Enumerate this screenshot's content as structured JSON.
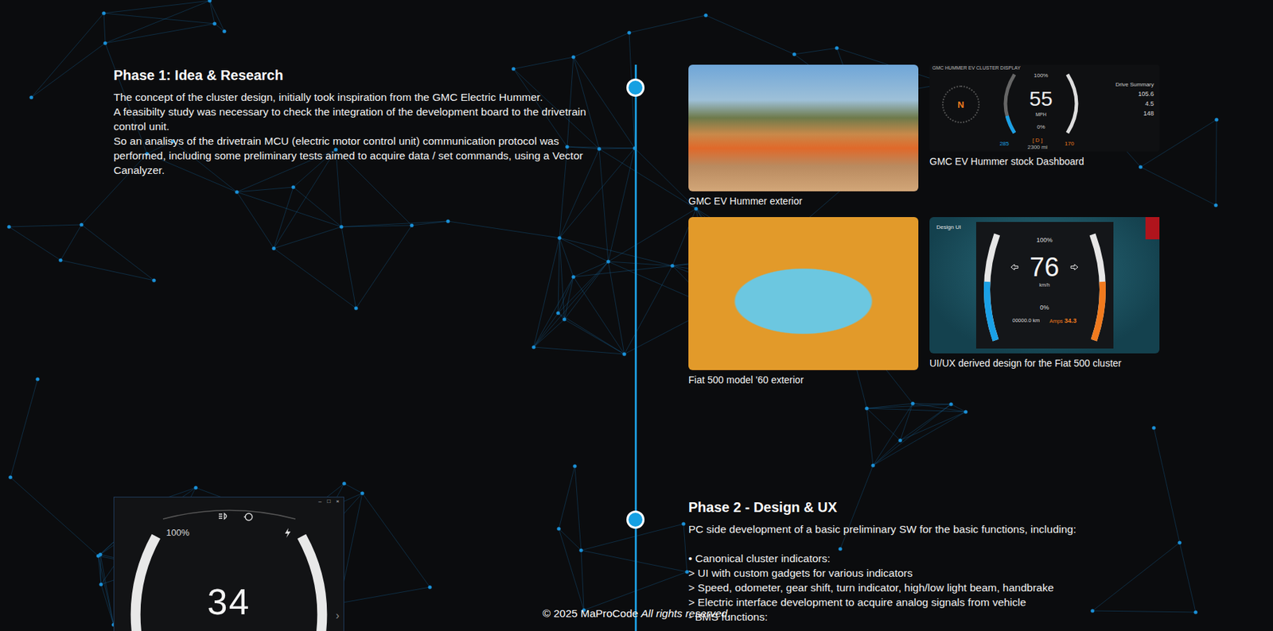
{
  "phases": [
    {
      "title": "Phase 1: Idea & Research",
      "paragraphs": [
        "The concept of the cluster design, initially took inspiration from the GMC Electric Hummer.",
        "A feasibilty study was necessary to check the integration of the development board to the drivetrain control unit.",
        "So an analisys of the drivetrain MCU (electric motor control unit) communication protocol was performed, including some preliminary tests aimed to acquire data / set commands, using a Vector Canalyzer."
      ],
      "media": [
        {
          "kind": "photo",
          "caption": "GMC EV Hummer exterior"
        },
        {
          "kind": "stock",
          "caption": "GMC EV Hummer stock Dashboard",
          "screen": {
            "header": "GMC HUMMER EV CLUSTER DISPLAY",
            "top": "100%",
            "gear": "N",
            "speed": "55",
            "unit": "MPH",
            "bottom": "0%",
            "range": "285",
            "drive": "[ D ]",
            "odometer": "2300 mi",
            "temp": "170",
            "summary_title": "Drive Summary",
            "summary": [
              "105.6",
              "4.5",
              "148"
            ],
            "level": 0.3
          }
        },
        {
          "kind": "photo",
          "caption": "Fiat 500 model '60 exterior"
        },
        {
          "kind": "design",
          "caption": "UI/UX derived design for the Fiat 500 cluster",
          "screen": {
            "label": "Design UI",
            "top": "100%",
            "speed": "76",
            "unit": "km/h",
            "bottom": "0%",
            "odometer": "00000.0 km",
            "amps_label": "Amps",
            "amps": "34.3",
            "level": 0.55
          }
        }
      ]
    },
    {
      "title": "Phase 2 - Design & UX",
      "paragraphs": [
        "PC side development of a basic preliminary SW for the basic functions, including:",
        "",
        "• Canonical cluster indicators:",
        "> UI with custom gadgets for various indicators",
        "> Speed, odometer, gear shift, turn indicator, high/low light beam, handbrake",
        "> Electric interface development to acquire analog signals from vehicle",
        "- BMS functions:"
      ],
      "media": [
        {
          "kind": "app",
          "screen": {
            "controls": [
              "–",
              "□",
              "×"
            ],
            "top": "100%",
            "speed": "34",
            "level": 0.18
          }
        }
      ]
    }
  ],
  "footer": {
    "copyright": "© 2025 MaProCode",
    "rights": "All rights reserved."
  }
}
